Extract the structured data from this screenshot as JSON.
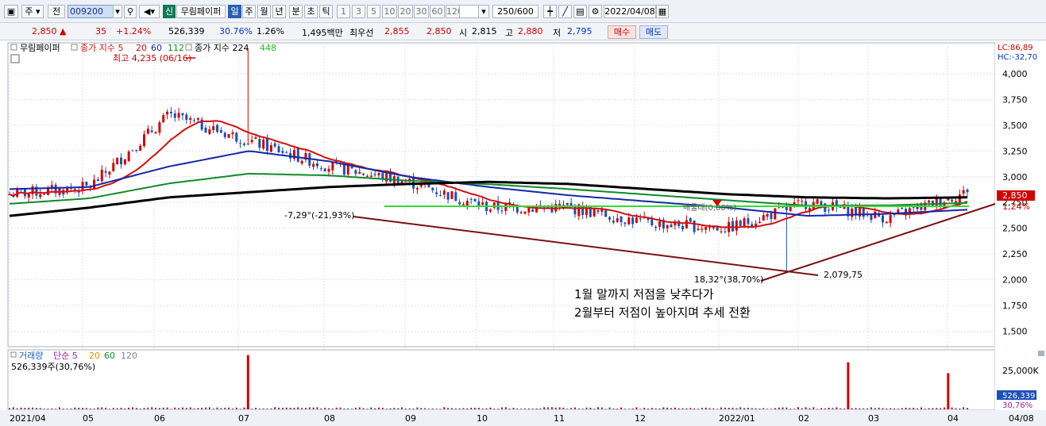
{
  "toolbar": {
    "market_label": "주",
    "prev_label": "전",
    "stock_code": "009200",
    "credit_badge": "신",
    "stock_name": "무림페이퍼",
    "periods": [
      "일",
      "주",
      "월",
      "년",
      "분",
      "초",
      "틱"
    ],
    "minutes": [
      "1",
      "3",
      "5",
      "10",
      "20",
      "30",
      "60",
      "120"
    ],
    "count_value": "250",
    "count_total": "/600",
    "date_value": "2022/04/08"
  },
  "quote": {
    "price": "2,850",
    "price_arrow": "▲",
    "change": "35",
    "change_pct": "+1.24%",
    "volume": "526,339",
    "volume_ratio": "30.76%",
    "turnover_pct": "1.26%",
    "amount": "1,495백만",
    "bid_label": "최우선",
    "bid1": "2,855",
    "bid2": "2,850",
    "open_label": "시",
    "open": "2,815",
    "high_label": "고",
    "high": "2,880",
    "low_label": "저",
    "low": "2,795",
    "buy_label": "매수",
    "sell_label": "매도"
  },
  "legend": {
    "stock": "무림페이퍼",
    "price_ma_label": "종가 지수 5",
    "ma20": "20",
    "ma60": "60",
    "ma112": "112",
    "ma224_label": "종가 지수 224",
    "ma448": "448",
    "lc": "LC:86,89",
    "hc": "HC:-32,70"
  },
  "annotations": {
    "high_note": "최고 4,235 (06/16)",
    "drop_note": "-7,29°(-21,93%)",
    "low_note": "18,32°(38,70%)",
    "low_value": "2,079,75",
    "mid_note": "매물대(0,00%)",
    "comment1": "1월  말까지  저점을  낮추다가",
    "comment2": "2월부터  저점이  높아지며  추세  전환"
  },
  "price_axis": {
    "ticks": [
      "4,000",
      "3,750",
      "3,500",
      "3,250",
      "3,000",
      "2,750",
      "2,500",
      "2,250",
      "2,000",
      "1,750",
      "1,500"
    ],
    "current": "2,850",
    "current_pct": "1,24%"
  },
  "volume_panel": {
    "legend_label": "거래량",
    "ma_label": "단순 5",
    "ma20": "20",
    "ma60": "60",
    "ma120": "120",
    "value_note": "526,339주(30,76%)",
    "axis_tick": "25,000K",
    "current": "526,339",
    "current_pct": "30,76%"
  },
  "date_axis": {
    "labels": [
      "2021/04",
      "05",
      "06",
      "07",
      "08",
      "09",
      "10",
      "11",
      "12",
      "2022/01",
      "02",
      "03",
      "04"
    ],
    "right_label": "04/08"
  },
  "colors": {
    "up": "#d40000",
    "down": "#1d4fb8",
    "ma5": "#d01010",
    "ma20": "#d01010",
    "ma60": "#1428a8",
    "ma112": "#118a2a",
    "ma224": "#000000",
    "ma448": "#33cc33",
    "trend": "#7a1010"
  },
  "chart_data": {
    "type": "candlestick",
    "ylim": [
      1350,
      4300
    ],
    "x": [
      "2021-04",
      "2021-05",
      "2021-06",
      "2021-07",
      "2021-08",
      "2021-09",
      "2021-10",
      "2021-11",
      "2021-12",
      "2022-01",
      "2022-02",
      "2022-03",
      "2022-04"
    ],
    "close_approx": [
      2830,
      2900,
      3600,
      3350,
      3100,
      2950,
      2700,
      2700,
      2550,
      2500,
      2750,
      2600,
      2850
    ],
    "ma60_approx": [
      2880,
      2900,
      3100,
      3250,
      3150,
      3000,
      2900,
      2820,
      2760,
      2700,
      2620,
      2640,
      2680
    ],
    "ma224_approx": [
      2620,
      2700,
      2800,
      2850,
      2900,
      2930,
      2950,
      2930,
      2880,
      2830,
      2800,
      2790,
      2800
    ],
    "annotation_points": {
      "high": 4235,
      "low": 2079.75,
      "last": 2850
    },
    "volume_peaks_k": [
      {
        "x": "2021-06",
        "v": 30000
      },
      {
        "x": "2022-02",
        "v": 26000
      },
      {
        "x": "2022-04",
        "v": 20000
      }
    ]
  }
}
